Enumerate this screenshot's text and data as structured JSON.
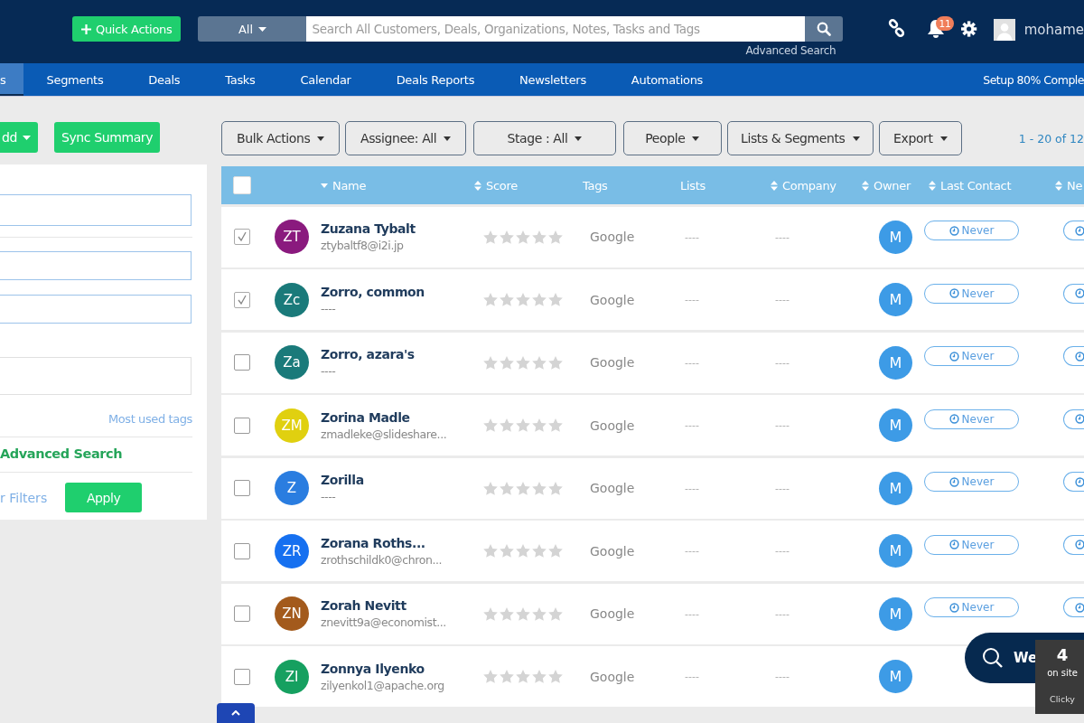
{
  "header": {
    "quick_actions": "Quick Actions",
    "search_scope": "All",
    "search_placeholder": "Search All Customers, Deals, Organizations, Notes, Tasks and Tags",
    "advanced_search": "Advanced Search",
    "notification_count": "11",
    "user_name": "mohame"
  },
  "nav": {
    "tabs": [
      {
        "label": "s",
        "selected": true
      },
      {
        "label": "Segments",
        "selected": false
      },
      {
        "label": "Deals",
        "selected": false
      },
      {
        "label": "Tasks",
        "selected": false
      },
      {
        "label": "Calendar",
        "selected": false
      },
      {
        "label": "Deals Reports",
        "selected": false
      },
      {
        "label": "Newsletters",
        "selected": false
      },
      {
        "label": "Automations",
        "selected": false
      }
    ],
    "setup": "Setup 80% Comple"
  },
  "sidebar": {
    "add_button": "dd",
    "sync_button": "Sync Summary",
    "most_used_tags": "Most used tags",
    "advanced_search": "Advanced Search",
    "clear_filters": "r Filters",
    "apply": "Apply"
  },
  "toolbar": {
    "buttons": [
      "Bulk Actions",
      "Assignee: All",
      "Stage : All",
      "People",
      "Lists & Segments",
      "Export"
    ],
    "pagination": "1 - 20 of 12"
  },
  "table": {
    "select_all": false,
    "columns": [
      {
        "label": "Name",
        "kind": "sorted"
      },
      {
        "label": "Score",
        "kind": "sortable"
      },
      {
        "label": "Tags",
        "kind": "plain"
      },
      {
        "label": "Lists",
        "kind": "plain"
      },
      {
        "label": "Company",
        "kind": "sortable"
      },
      {
        "label": "Owner",
        "kind": "sortable"
      },
      {
        "label": "Last Contact",
        "kind": "sortable"
      },
      {
        "label": "Ne",
        "kind": "sortable"
      }
    ],
    "rows": [
      {
        "checked": true,
        "initials": "ZT",
        "color": "#8a1a7e",
        "name": "Zuzana Tybalt",
        "email": "ztybaltf8@i2i.jp",
        "stars": 0,
        "tags": "Google",
        "lists": "----",
        "company": "----",
        "owner": "M",
        "last_contact": "Never"
      },
      {
        "checked": true,
        "initials": "Zc",
        "color": "#1a7a7a",
        "name": "Zorro, common",
        "email": "----",
        "stars": 0,
        "tags": "Google",
        "lists": "----",
        "company": "----",
        "owner": "M",
        "last_contact": "Never"
      },
      {
        "checked": false,
        "initials": "Za",
        "color": "#1a7a7a",
        "name": "Zorro, azara's",
        "email": "----",
        "stars": 0,
        "tags": "Google",
        "lists": "----",
        "company": "----",
        "owner": "M",
        "last_contact": "Never"
      },
      {
        "checked": false,
        "initials": "ZM",
        "color": "#e0d010",
        "name": "Zorina Madle",
        "email": "zmadleke@slideshare...",
        "stars": 0,
        "tags": "Google",
        "lists": "----",
        "company": "----",
        "owner": "M",
        "last_contact": "Never"
      },
      {
        "checked": false,
        "initials": "Z",
        "color": "#2a7de0",
        "name": "Zorilla",
        "email": "----",
        "stars": 0,
        "tags": "Google",
        "lists": "----",
        "company": "----",
        "owner": "M",
        "last_contact": "Never"
      },
      {
        "checked": false,
        "initials": "ZR",
        "color": "#1670f0",
        "name": "Zorana Roths...",
        "email": "zrothschildk0@chron...",
        "stars": 0,
        "tags": "Google",
        "lists": "----",
        "company": "----",
        "owner": "M",
        "last_contact": "Never"
      },
      {
        "checked": false,
        "initials": "ZN",
        "color": "#a35a1c",
        "name": "Zorah Nevitt",
        "email": "znevitt9a@economist...",
        "stars": 0,
        "tags": "Google",
        "lists": "----",
        "company": "----",
        "owner": "M",
        "last_contact": "Never"
      },
      {
        "checked": false,
        "initials": "ZI",
        "color": "#16a060",
        "name": "Zonnya Ilyenko",
        "email": "zilyenkol1@apache.org",
        "stars": 0,
        "tags": "Google",
        "lists": "----",
        "company": "----",
        "owner": "M",
        "last_contact": null
      }
    ]
  },
  "chat_widget": {
    "label": "We",
    "visitors": "4",
    "visitors_label": "on site",
    "brand": "Clicky"
  }
}
